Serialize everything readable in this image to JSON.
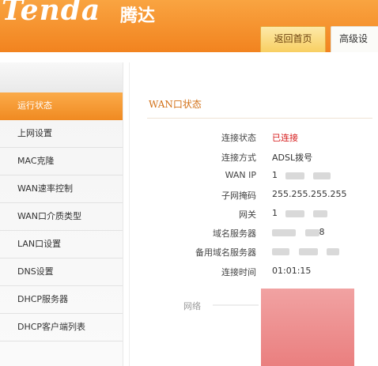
{
  "brand": {
    "logo": "Tenda",
    "name_cn": "腾达"
  },
  "tabs": [
    {
      "label": "返回首页"
    },
    {
      "label": "高级设"
    }
  ],
  "sidebar": {
    "items": [
      {
        "label": "运行状态"
      },
      {
        "label": "上网设置"
      },
      {
        "label": "MAC克隆"
      },
      {
        "label": "WAN速率控制"
      },
      {
        "label": "WAN口介质类型"
      },
      {
        "label": "LAN口设置"
      },
      {
        "label": "DNS设置"
      },
      {
        "label": "DHCP服务器"
      },
      {
        "label": "DHCP客户端列表"
      }
    ]
  },
  "wan": {
    "title": "WAN口状态",
    "rows": [
      {
        "label": "连接状态",
        "value": "已连接"
      },
      {
        "label": "连接方式",
        "value": "ADSL拨号"
      },
      {
        "label": "WAN IP",
        "value": "1"
      },
      {
        "label": "子网掩码",
        "value": "255.255.255.255"
      },
      {
        "label": "网关",
        "value": "1"
      },
      {
        "label": "域名服务器",
        "value": "8"
      },
      {
        "label": "备用域名服务器",
        "value": ""
      },
      {
        "label": "连接时间",
        "value": "01:01:15"
      }
    ],
    "network_label": "网络"
  },
  "colors": {
    "accent": "#f2831f",
    "status_connected": "#d61b1b"
  }
}
